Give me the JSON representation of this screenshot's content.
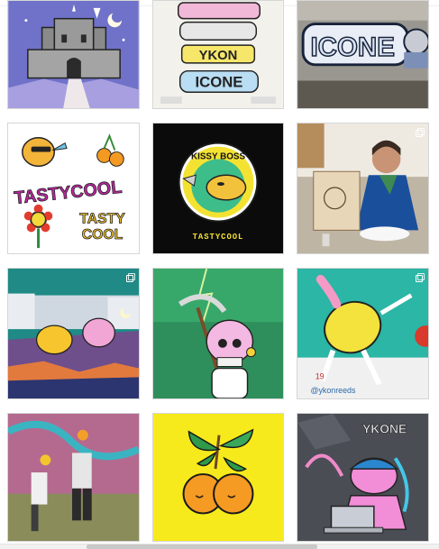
{
  "tiles": [
    {
      "name": "castle-illustration"
    },
    {
      "name": "lettering-sketches",
      "texts": [
        "ICONE",
        "YKON"
      ]
    },
    {
      "name": "icone-graffiti-wall",
      "text": "ICONE"
    },
    {
      "name": "tastycool-stickers",
      "texts": [
        "TASTYCOOL",
        "TASTY",
        "COOL"
      ]
    },
    {
      "name": "kissy-boss-logo",
      "texts": [
        "KISSY BOSS",
        "TASTYCOOL"
      ]
    },
    {
      "name": "artist-at-table"
    },
    {
      "name": "night-dance-illustration"
    },
    {
      "name": "skull-reaper-illustration"
    },
    {
      "name": "lemon-mural",
      "text": "@ykonreeds"
    },
    {
      "name": "painting-wall-photo"
    },
    {
      "name": "oranges-illustration"
    },
    {
      "name": "laptop-graffiti-character",
      "text": "YKONE"
    }
  ],
  "colors": {
    "accent": "#f7ea1c",
    "dark": "#111111"
  }
}
